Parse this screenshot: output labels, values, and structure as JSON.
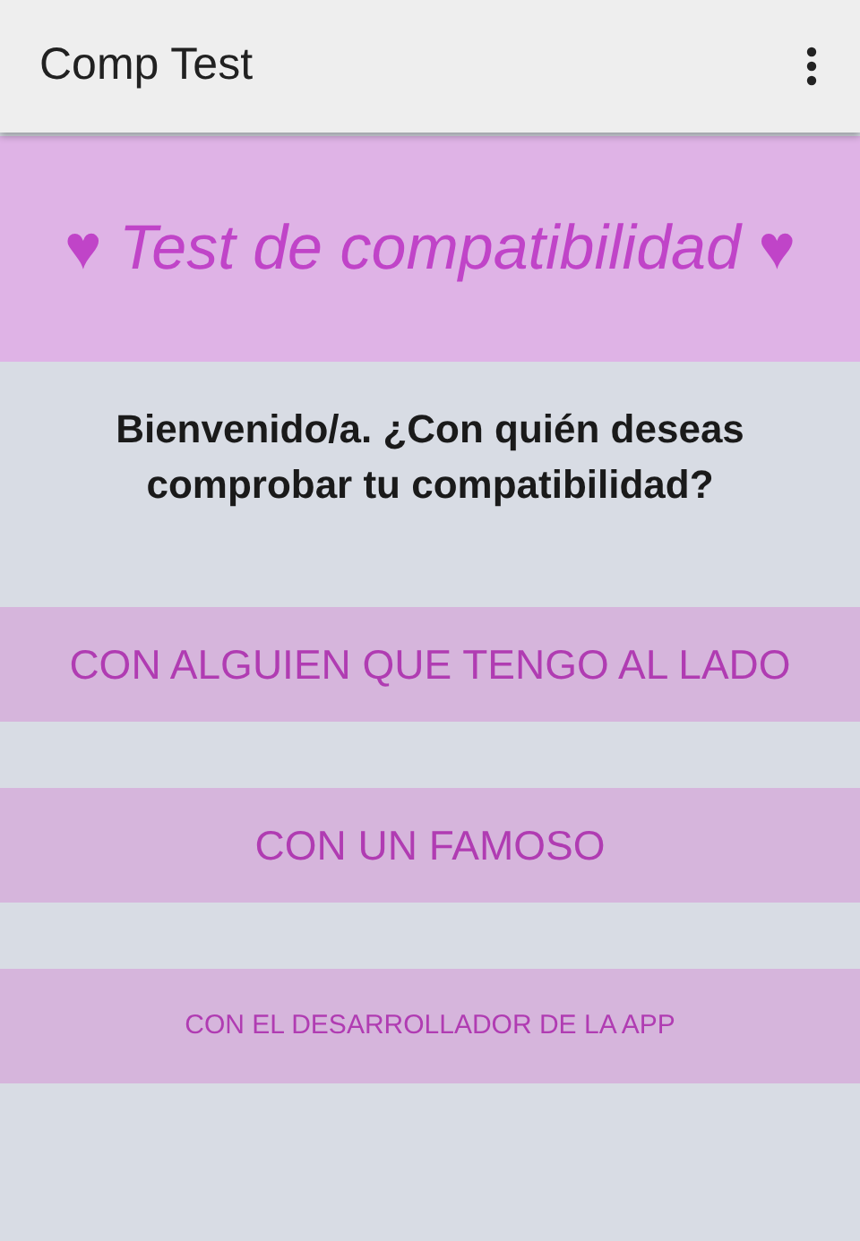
{
  "app_bar": {
    "title": "Comp Test"
  },
  "banner": {
    "title": "♥ Test de compatibilidad ♥"
  },
  "prompt": "Bienvenido/a.  ¿Con quién deseas comprobar tu compatibilidad?",
  "options": [
    {
      "label": "CON ALGUIEN QUE TENGO AL LADO",
      "kind": "large"
    },
    {
      "label": "CON UN FAMOSO",
      "kind": "large"
    },
    {
      "label": "CON EL DESARROLLADOR DE LA APP",
      "kind": "small"
    }
  ]
}
